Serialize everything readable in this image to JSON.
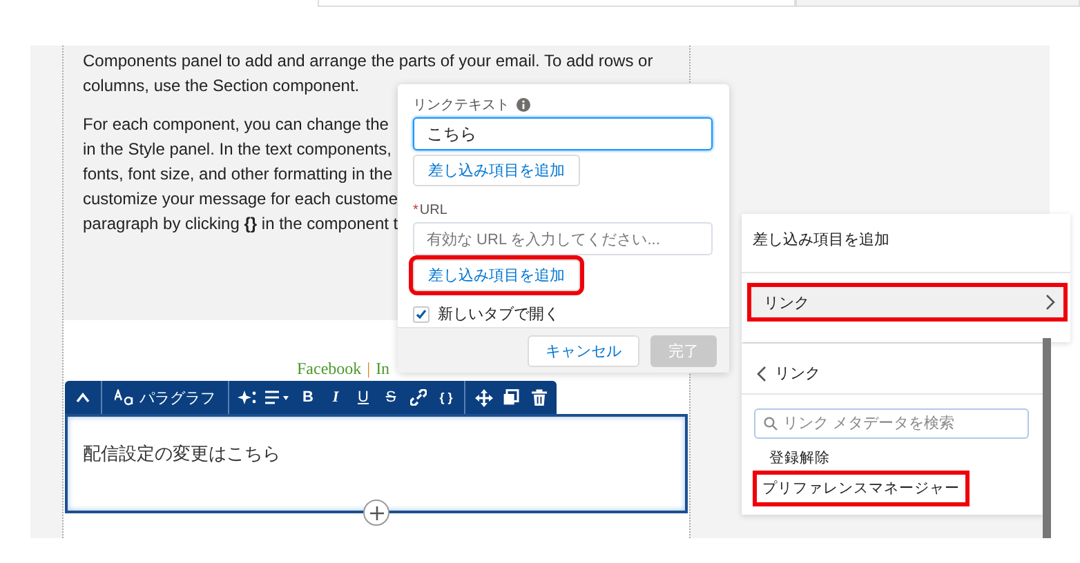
{
  "email_body": {
    "paragraphs": [
      {
        "lines": [
          "Components panel to add and arrange the parts of your email. To add rows or",
          "columns, use the Section component."
        ]
      },
      {
        "lines": [
          "For each component, you can change the",
          "in the Style panel. In the text components,",
          "fonts, font size, and other formatting in the",
          "customize your message for each custome",
          "paragraph by clicking **{}** in the component t"
        ]
      }
    ]
  },
  "social_links": [
    {
      "label": "Facebook",
      "kind": "link"
    },
    {
      "label": "|",
      "kind": "separator"
    },
    {
      "label": "In",
      "kind": "link"
    }
  ],
  "toolbar": [
    {
      "kind": "collapse"
    },
    {
      "kind": "style",
      "label": "パラグラフ"
    },
    {
      "kind": "sparkle"
    },
    {
      "kind": "align"
    },
    {
      "kind": "bold",
      "label": "B"
    },
    {
      "kind": "italic",
      "label": "I"
    },
    {
      "kind": "underline",
      "label": "U"
    },
    {
      "kind": "strike",
      "label": "S"
    },
    {
      "kind": "link"
    },
    {
      "kind": "merge",
      "label": "{ }"
    },
    {
      "kind": "move"
    },
    {
      "kind": "copy"
    },
    {
      "kind": "delete"
    }
  ],
  "editor": {
    "text": "配信設定の変更はこちら",
    "selected": true
  },
  "link_popover": {
    "link_text": {
      "label": "リンクテキスト",
      "value": "こちら",
      "focused": true,
      "merge_button": {
        "label": "差し込み項目を追加",
        "highlighted": false
      }
    },
    "url": {
      "label": "URL",
      "required_mark": "*",
      "placeholder": "有効な URL を入力してください...",
      "merge_button": {
        "label": "差し込み項目を追加",
        "highlighted": true
      }
    },
    "new_tab": {
      "label": "新しいタブで開く",
      "checked": true
    },
    "buttons": [
      {
        "label": "キャンセル",
        "disabled": false
      },
      {
        "label": "完了",
        "disabled": true
      }
    ]
  },
  "merge_panel": {
    "title": "差し込み項目を追加",
    "items": [
      {
        "label": "リンク",
        "highlighted": true
      }
    ]
  },
  "link_submenu": {
    "back_label": "リンク",
    "search": {
      "placeholder": "リンク メタデータを検索"
    },
    "items": [
      {
        "label": "登録解除",
        "highlighted": false
      },
      {
        "label": "プリファレンスマネージャー",
        "highlighted": true
      }
    ]
  }
}
